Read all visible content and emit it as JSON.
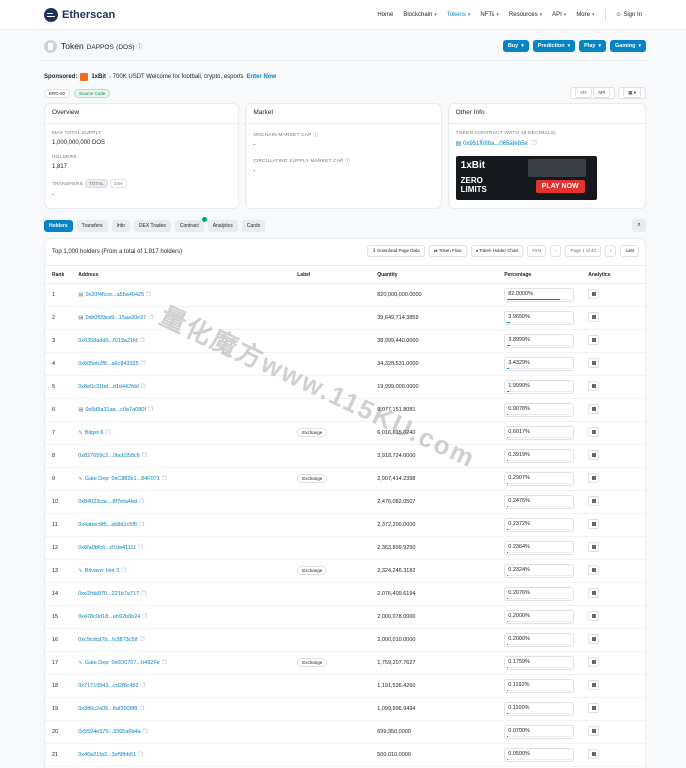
{
  "header": {
    "brand": "Etherscan",
    "nav": [
      "Home",
      "Blockchain",
      "Tokens",
      "NFTs",
      "Resources",
      "API",
      "More"
    ],
    "signin": "Sign In"
  },
  "title": {
    "prefix": "Token",
    "name": "DAPPOS",
    "symbol": "(DOS)"
  },
  "header_buttons": [
    "Buy",
    "Prediction",
    "Play",
    "Gaming"
  ],
  "sponsored": {
    "label": "Sponsored:",
    "brand": "1xBit",
    "text": "- 700K USDT Welcome for football, crypto, esports",
    "cta": "Enter Now"
  },
  "tags": [
    "ERC-20",
    "Source Code"
  ],
  "tag_right": [
    "API",
    ""
  ],
  "overview": {
    "title": "Overview",
    "max_supply_label": "MAX TOTAL SUPPLY",
    "max_supply": "1,000,000,000 DOS",
    "holders_label": "HOLDERS",
    "holders": "1,817",
    "transfers_label": "TRANSFERS",
    "transfers_total": "TOTAL",
    "transfers_24h": "24H",
    "transfers": "-"
  },
  "market": {
    "title": "Market",
    "onchain_label": "ONCHAIN MARKET CAP",
    "onchain": "-",
    "circ_label": "CIRCULATING SUPPLY MARKET CAP",
    "circ": "-"
  },
  "other": {
    "title": "Other Info",
    "contract_label": "TOKEN CONTRACT (WITH 18 DECIMALS)",
    "contract": "0x951f086a...065afeb5e",
    "ad": {
      "l1": "1xBit",
      "l2": "ZERO",
      "l3": "LIMITS",
      "cta": "PLAY NOW"
    }
  },
  "tabs": [
    "Holders",
    "Transfers",
    "Info",
    "DEX Trades",
    "Contract",
    "Analytics",
    "Cards"
  ],
  "panel": {
    "summary": "Top 1,000 holders (From a total of 1,817 holders)",
    "actions": [
      "Download Page Data",
      "Token Flow",
      "Token Holder Chart",
      "First",
      "Page 1 of 40",
      "Last"
    ]
  },
  "columns": [
    "Rank",
    "Address",
    "Label",
    "Quantity",
    "Percentage",
    "Analytics"
  ],
  "rows": [
    {
      "rank": "1",
      "address": "0x20f4fcce...a5ba40425",
      "doc": true,
      "label": "",
      "qty": "820,000,000.0000",
      "pct": "82.0000%",
      "p": 82
    },
    {
      "rank": "2",
      "address": "0xb0f09ea9...15aa30e37",
      "doc": true,
      "label": "",
      "qty": "39,649,714.3859",
      "pct": "3.9650%",
      "p": 3.965
    },
    {
      "rank": "3",
      "address": "0x0358add0...f019a21fd",
      "doc": false,
      "label": "",
      "qty": "38,999,440.0000",
      "pct": "3.8999%",
      "p": 3.8999
    },
    {
      "rank": "4",
      "address": "0x605eb2f8...a6c843325",
      "doc": false,
      "label": "",
      "qty": "34,328,531.0000",
      "pct": "3.4329%",
      "p": 3.4329
    },
    {
      "rank": "5",
      "address": "0x8e0c31bd...d1d442fdd",
      "doc": false,
      "label": "",
      "qty": "19,999,000.0000",
      "pct": "1.9999%",
      "p": 1.9999
    },
    {
      "rank": "6",
      "address": "0x6d8a31ae...c0e7a080f",
      "doc": true,
      "label": "",
      "qty": "9,077,151.8081",
      "pct": "0.9078%",
      "p": 0.9078
    },
    {
      "rank": "7",
      "address": "Bitget 6",
      "doc": false,
      "label": "Exchange",
      "qty": "6,016,615.0240",
      "pct": "0.6017%",
      "p": 0.6017
    },
    {
      "rank": "8",
      "address": "0x827659c2...0bcb358c6",
      "doc": false,
      "label": "",
      "qty": "3,918,724.0000",
      "pct": "0.3919%",
      "p": 0.3919
    },
    {
      "rank": "9",
      "address": "Gate.Dep: 0xC882b1...84F071",
      "doc": false,
      "label": "Exchange",
      "qty": "2,907,414.2398",
      "pct": "0.2907%",
      "p": 0.2907
    },
    {
      "rank": "10",
      "address": "0x84023cac...8f7efa4bd",
      "doc": false,
      "label": "",
      "qty": "2,476,082.0507",
      "pct": "0.2476%",
      "p": 0.2476
    },
    {
      "rank": "11",
      "address": "0x4abec9f5...ab8d1c5f8",
      "doc": false,
      "label": "",
      "qty": "2,372,200.0000",
      "pct": "0.2372%",
      "p": 0.2372
    },
    {
      "rank": "12",
      "address": "0x6fa0bfc6...d7da41111",
      "doc": false,
      "label": "",
      "qty": "2,363,899.9250",
      "pct": "0.2364%",
      "p": 0.2364
    },
    {
      "rank": "13",
      "address": "Bitvavo: Hot 3",
      "doc": false,
      "label": "Exchange",
      "qty": "2,324,246.3182",
      "pct": "0.2324%",
      "p": 0.2324
    },
    {
      "rank": "14",
      "address": "0xe2fda970...221b7a717",
      "doc": false,
      "label": "",
      "qty": "2,076,409.6194",
      "pct": "0.2076%",
      "p": 0.2076
    },
    {
      "rank": "15",
      "address": "0x478c0d18...eb92b0b24",
      "doc": false,
      "label": "",
      "qty": "2,000,078.0000",
      "pct": "0.2000%",
      "p": 0.2
    },
    {
      "rank": "16",
      "address": "0xc9cdcd7b...fc3873c58",
      "doc": false,
      "label": "",
      "qty": "2,000,010.0000",
      "pct": "0.2000%",
      "p": 0.2
    },
    {
      "rank": "17",
      "address": "Gate.Dep: 0x0D0707...b492Fe",
      "doc": false,
      "label": "Exchange",
      "qty": "1,759,207.7627",
      "pct": "0.1759%",
      "p": 0.1759
    },
    {
      "rank": "18",
      "address": "0x71719543...cd2f8c463",
      "doc": false,
      "label": "",
      "qty": "1,191,536.4260",
      "pct": "0.1192%",
      "p": 0.1192
    },
    {
      "rank": "19",
      "address": "0x386c2a05...8af3508f8",
      "doc": false,
      "label": "",
      "qty": "1,099,996.9494",
      "pct": "0.1100%",
      "p": 0.11
    },
    {
      "rank": "20",
      "address": "0x5594e570...3365a6b4a",
      "doc": false,
      "label": "",
      "qty": "699,950.0000",
      "pct": "0.0700%",
      "p": 0.07
    },
    {
      "rank": "21",
      "address": "0x46a21fa3...3ef9fbb51",
      "doc": false,
      "label": "",
      "qty": "500,010.0000",
      "pct": "0.0500%",
      "p": 0.05
    }
  ],
  "watermark": "量化魔方www.115KU.com"
}
